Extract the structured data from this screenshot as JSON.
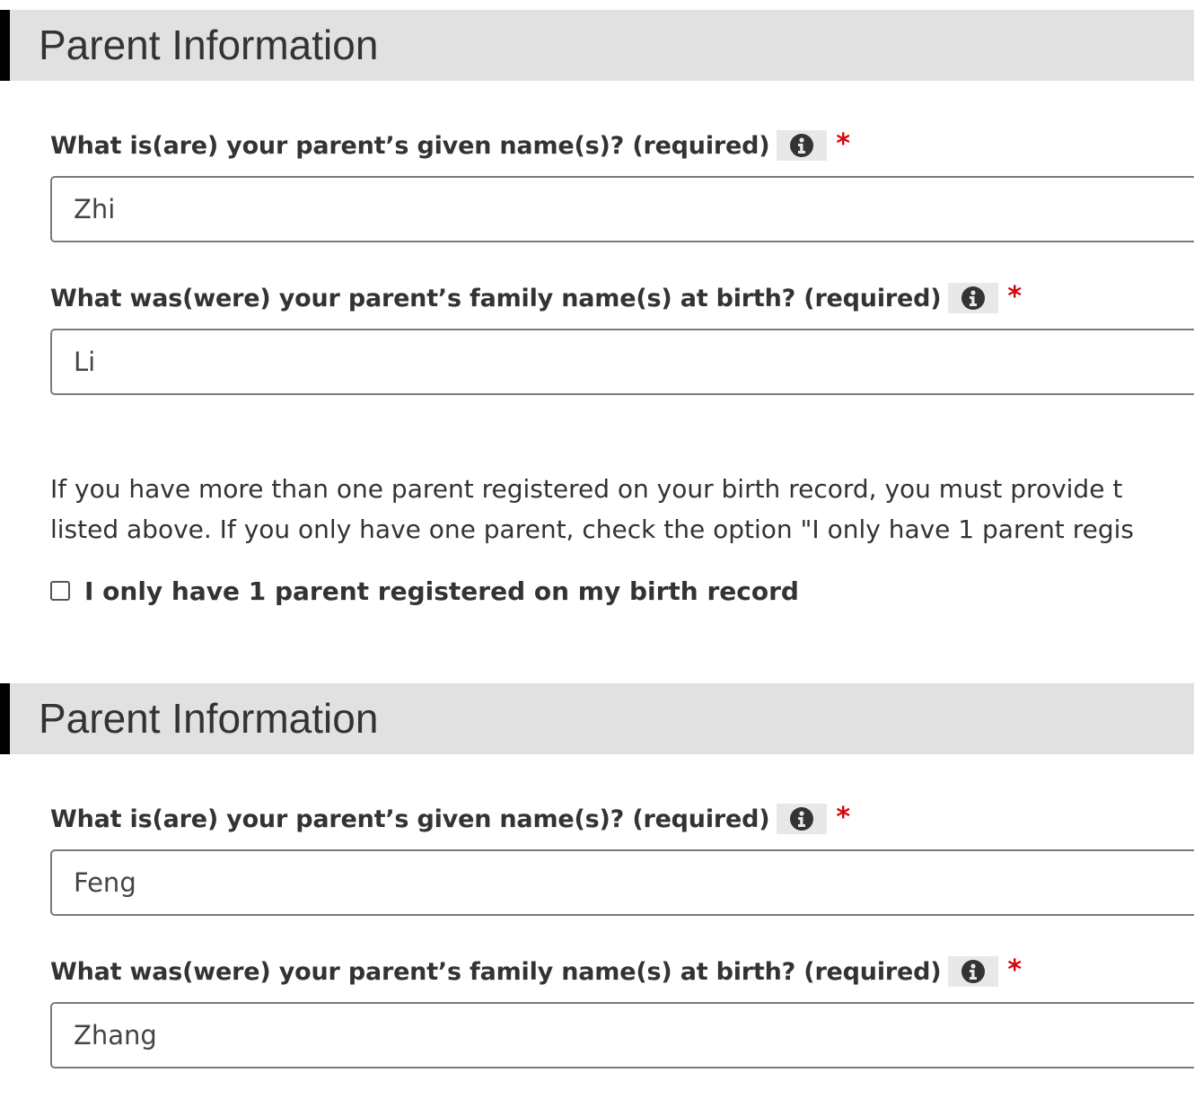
{
  "sections": [
    {
      "title": "Parent Information",
      "given_name": {
        "label": "What is(are) your parent’s given name(s)? (required)",
        "value": "Zhi",
        "required_mark": "*",
        "info_icon": "info-circle-icon"
      },
      "family_name": {
        "label": "What was(were) your parent’s family name(s) at birth? (required)",
        "value": "Li",
        "required_mark": "*",
        "info_icon": "info-circle-icon"
      }
    },
    {
      "title": "Parent Information",
      "given_name": {
        "label": "What is(are) your parent’s given name(s)? (required)",
        "value": "Feng",
        "required_mark": "*",
        "info_icon": "info-circle-icon"
      },
      "family_name": {
        "label": "What was(were) your parent’s family name(s) at birth? (required)",
        "value": "Zhang",
        "required_mark": "*",
        "info_icon": "info-circle-icon"
      }
    }
  ],
  "help_text": {
    "line1": "If you have more than one parent registered on your birth record, you must provide t",
    "line2": "listed above. If you only have one parent, check the option \"I only have 1 parent regis"
  },
  "single_parent_checkbox": {
    "label": "I only have 1 parent registered on my birth record",
    "checked": false
  },
  "colors": {
    "header_background": "#e1e1e1",
    "header_accent": "#000000",
    "required_star": "#d3080c",
    "text": "#333333",
    "input_border": "#7a7a7a"
  }
}
